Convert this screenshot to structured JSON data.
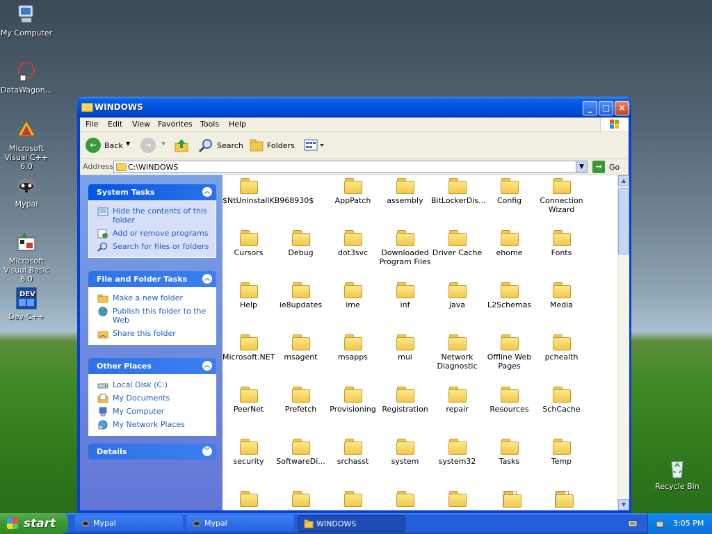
{
  "desktop": {
    "icons": [
      {
        "label": "My Computer"
      },
      {
        "label": "DataWagon..."
      },
      {
        "label": "Microsoft Visual C++ 6.0"
      },
      {
        "label": "Mypal"
      },
      {
        "label": "Microsoft Visual Basic 6.0"
      },
      {
        "label": "Dev-C++"
      },
      {
        "label": "Recycle Bin"
      }
    ]
  },
  "window": {
    "title": "WINDOWS",
    "menu": [
      "File",
      "Edit",
      "View",
      "Favorites",
      "Tools",
      "Help"
    ],
    "toolbar": {
      "back": "Back",
      "search": "Search",
      "folders": "Folders"
    },
    "address": {
      "label": "Address",
      "value": "C:\\WINDOWS",
      "go": "Go"
    }
  },
  "side_panels": {
    "system_tasks": {
      "title": "System Tasks",
      "links": [
        "Hide the contents of this folder",
        "Add or remove programs",
        "Search for files or folders"
      ]
    },
    "file_folder_tasks": {
      "title": "File and Folder Tasks",
      "links": [
        "Make a new folder",
        "Publish this folder to the Web",
        "Share this folder"
      ]
    },
    "other_places": {
      "title": "Other Places",
      "links": [
        "Local Disk (C:)",
        "My Documents",
        "My Computer",
        "My Network Places"
      ]
    },
    "details": {
      "title": "Details"
    }
  },
  "folders": [
    "$NtUninstallKB968930$",
    "AppPatch",
    "assembly",
    "BitLockerDis...",
    "Config",
    "Connection Wizard",
    "Cursors",
    "Debug",
    "dot3svc",
    "Downloaded Program Files",
    "Driver Cache",
    "ehome",
    "Fonts",
    "Help",
    "ie8updates",
    "ime",
    "inf",
    "java",
    "L2Schemas",
    "Media",
    "Microsoft.NET",
    "msagent",
    "msapps",
    "mui",
    "Network Diagnostic",
    "Offline Web Pages",
    "pchealth",
    "PeerNet",
    "Prefetch",
    "Provisioning",
    "Registration",
    "repair",
    "Resources",
    "SchCache",
    "security",
    "SoftwareDi...",
    "srchasst",
    "system",
    "system32",
    "Tasks",
    "Temp"
  ],
  "taskbar": {
    "start": "start",
    "tasks": [
      {
        "label": "Mypal",
        "active": false
      },
      {
        "label": "Mypal",
        "active": false
      },
      {
        "label": "WINDOWS",
        "active": true
      }
    ],
    "clock": "3:05 PM"
  }
}
